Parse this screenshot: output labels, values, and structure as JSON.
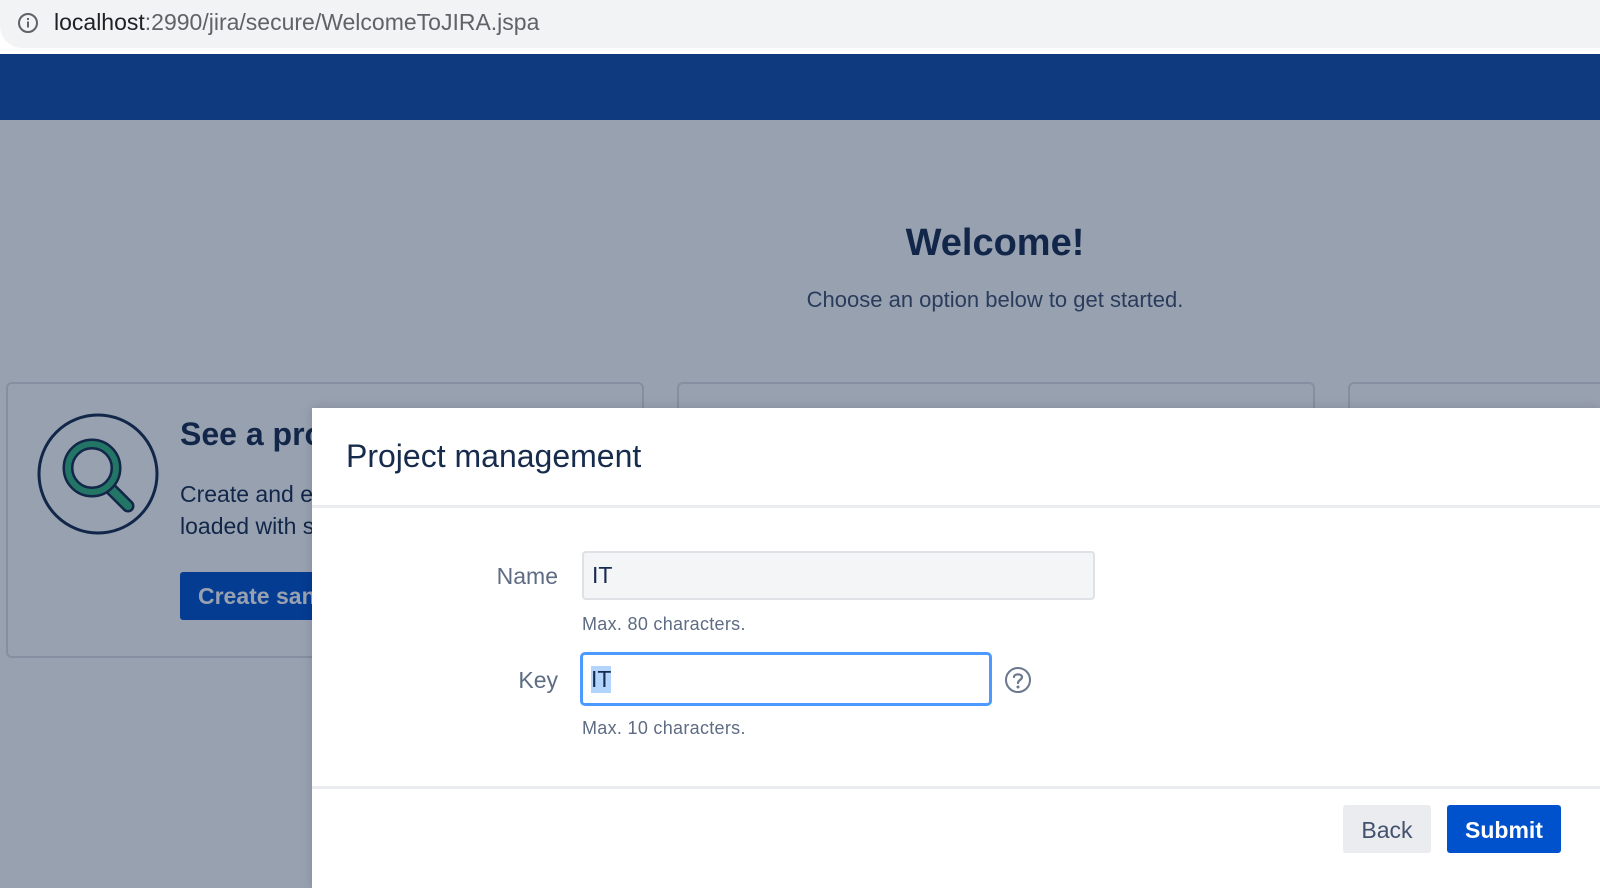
{
  "browser": {
    "url_host": "localhost",
    "url_path": ":2990/jira/secure/WelcomeToJIRA.jspa"
  },
  "welcome": {
    "title": "Welcome!",
    "subtitle": "Choose an option below to get started."
  },
  "cards": [
    {
      "title": "See a pro",
      "desc_line1": "Create and e",
      "desc_line2": "loaded with s",
      "button": "Create san"
    }
  ],
  "dialog": {
    "title": "Project management",
    "name_label": "Name",
    "name_value": "IT",
    "name_hint": "Max. 80 characters.",
    "key_label": "Key",
    "key_value": "IT",
    "key_hint": "Max. 10 characters.",
    "back_label": "Back",
    "submit_label": "Submit"
  },
  "colors": {
    "nav": "#0f3a80",
    "primary_button": "#0052cc",
    "focus_ring": "#4c9aff",
    "title_text": "#172b4d"
  }
}
